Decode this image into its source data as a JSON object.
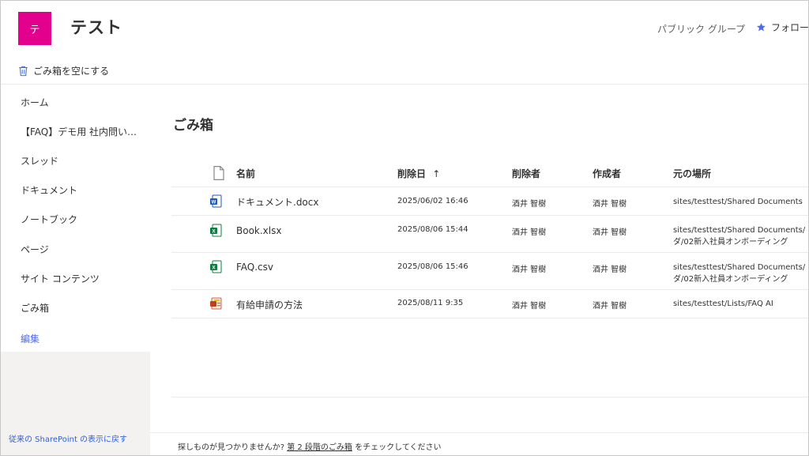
{
  "header": {
    "logo_letter": "テ",
    "site_title": "テスト",
    "group_type": "パブリック グループ",
    "follow_label": "フォロー"
  },
  "command_bar": {
    "empty_recycle_bin": "ごみ箱を空にする"
  },
  "sidebar": {
    "items": [
      {
        "label": "ホーム"
      },
      {
        "label": "【FAQ】デモ用 社内問い…"
      },
      {
        "label": "スレッド"
      },
      {
        "label": "ドキュメント"
      },
      {
        "label": "ノートブック"
      },
      {
        "label": "ページ"
      },
      {
        "label": "サイト コンテンツ"
      },
      {
        "label": "ごみ箱"
      }
    ],
    "edit_label": "編集",
    "classic_link": "従来の SharePoint の表示に戻す"
  },
  "main": {
    "page_title": "ごみ箱",
    "columns": {
      "name": "名前",
      "deleted_date": "削除日",
      "deleted_sort_arrow": "↑",
      "deleted_by": "削除者",
      "created_by": "作成者",
      "original_location": "元の場所"
    },
    "rows": [
      {
        "icon": "word-file-icon",
        "name": "ドキュメント.docx",
        "deleted": "2025/06/02 16:46",
        "deleted_by": "酒井 智樹",
        "created_by": "酒井 智樹",
        "location_line1": "sites/testtest/Shared Documents",
        "location_line2": ""
      },
      {
        "icon": "excel-file-icon",
        "name": "Book.xlsx",
        "deleted": "2025/08/06 15:44",
        "deleted_by": "酒井 智樹",
        "created_by": "酒井 智樹",
        "location_line1": "sites/testtest/Shared Documents/【デモ",
        "location_line2": "ダ/02新入社員オンボーディング"
      },
      {
        "icon": "excel-file-icon",
        "name": "FAQ.csv",
        "deleted": "2025/08/06 15:46",
        "deleted_by": "酒井 智樹",
        "created_by": "酒井 智樹",
        "location_line1": "sites/testtest/Shared Documents/【デモ",
        "location_line2": "ダ/02新入社員オンボーディング"
      },
      {
        "icon": "list-item-icon",
        "name": "有給申請の方法",
        "deleted": "2025/08/11 9:35",
        "deleted_by": "酒井 智樹",
        "created_by": "酒井 智樹",
        "location_line1": "sites/testtest/Lists/FAQ AI",
        "location_line2": ""
      }
    ],
    "footer": {
      "prefix": "探しものが見つかりませんか?",
      "link": "第 2 段階のごみ箱",
      "suffix": "をチェックしてください"
    }
  },
  "colors": {
    "logo_bg": "#e3008c",
    "accent_blue": "#4f6bed",
    "word_blue": "#185abd",
    "excel_green": "#107c41"
  }
}
